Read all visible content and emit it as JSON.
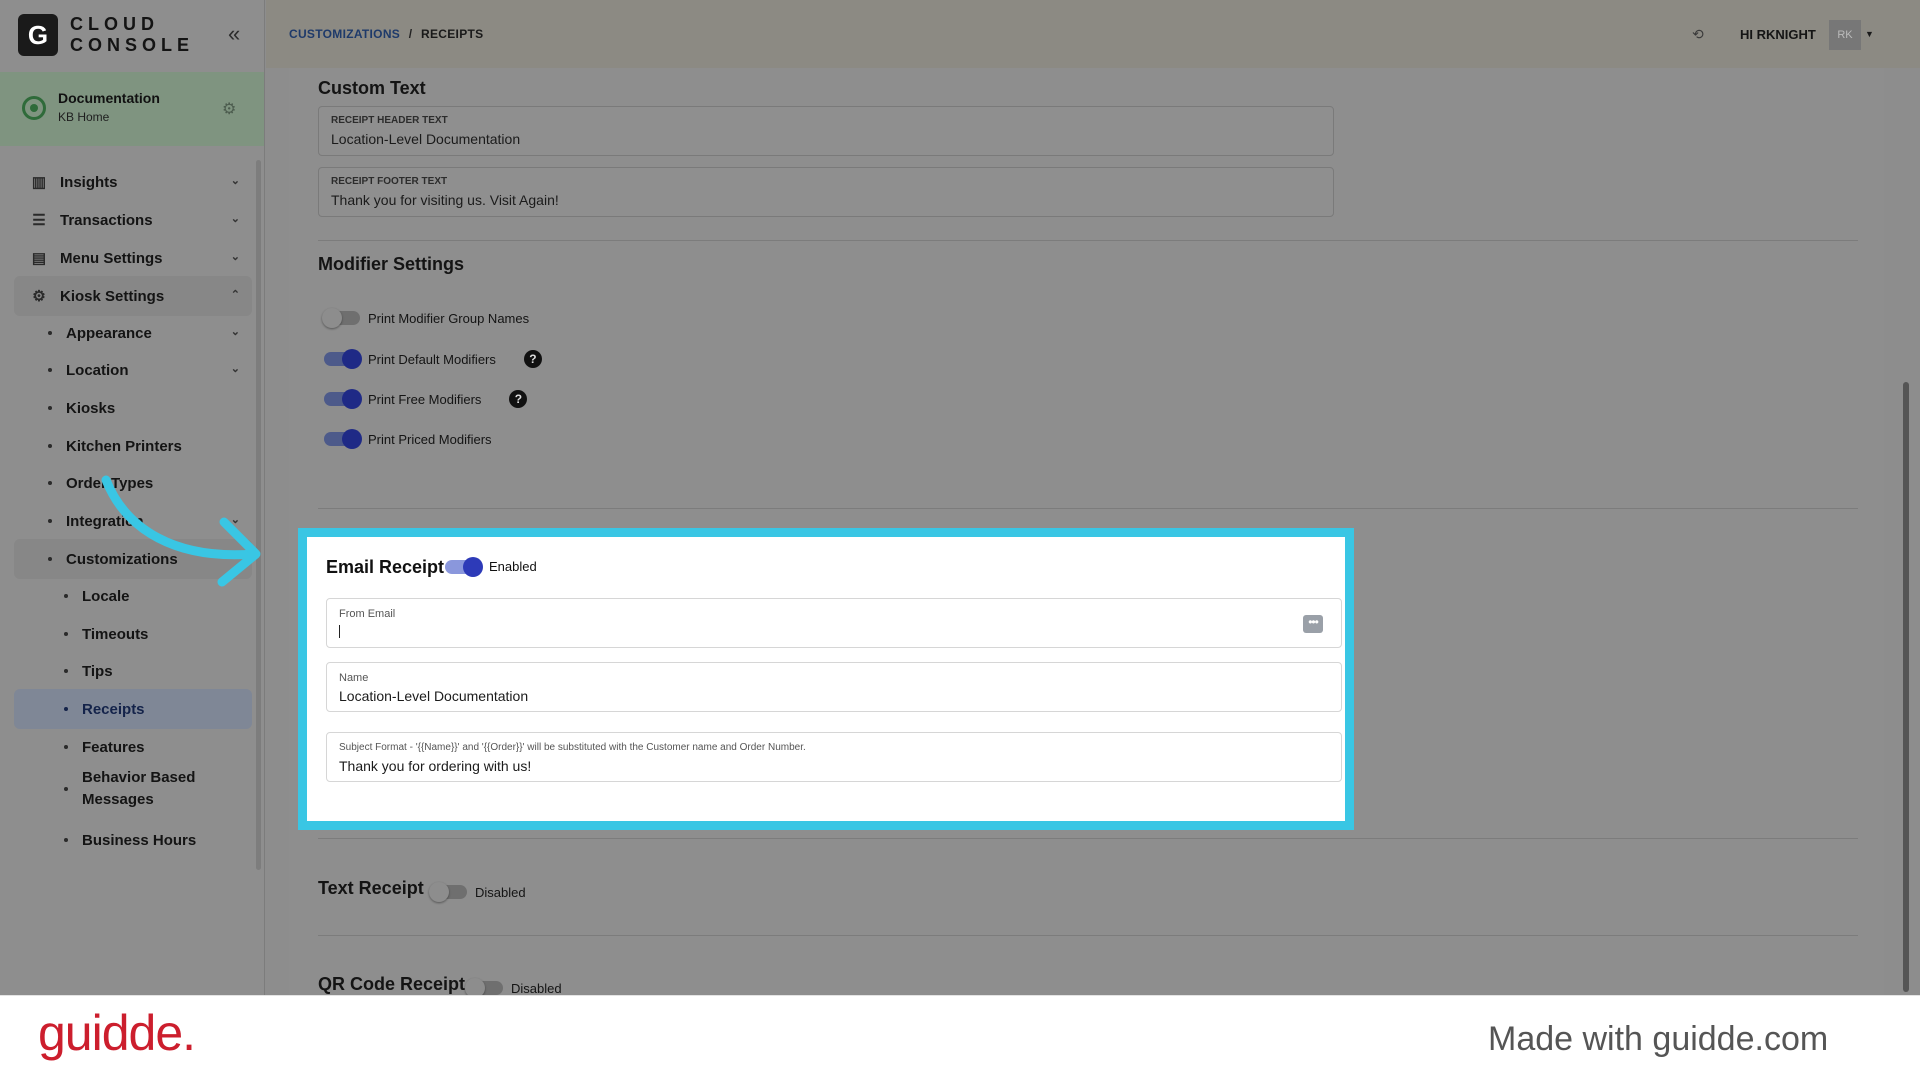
{
  "app": {
    "logo_letter": "G",
    "logo_line1": "CLOUD",
    "logo_line2": "CONSOLE"
  },
  "location": {
    "title": "Documentation",
    "subtitle": "KB Home"
  },
  "nav": {
    "insights": "Insights",
    "transactions": "Transactions",
    "menu_settings": "Menu Settings",
    "kiosk_settings": "Kiosk Settings",
    "appearance": "Appearance",
    "location": "Location",
    "kiosks": "Kiosks",
    "kitchen_printers": "Kitchen Printers",
    "order_types": "Order Types",
    "integration": "Integration",
    "customizations": "Customizations",
    "locale": "Locale",
    "timeouts": "Timeouts",
    "tips": "Tips",
    "receipts": "Receipts",
    "features": "Features",
    "behavior_line1": "Behavior Based",
    "behavior_line2": "Messages",
    "business_hours": "Business Hours"
  },
  "header": {
    "crumb_parent": "CUSTOMIZATIONS",
    "crumb_sep": "/",
    "crumb_current": "RECEIPTS",
    "greeting": "HI RKNIGHT",
    "avatar_initials": "RK"
  },
  "custom_text": {
    "title": "Custom Text",
    "header_label": "RECEIPT HEADER TEXT",
    "header_value": "Location-Level Documentation",
    "footer_label": "RECEIPT FOOTER TEXT",
    "footer_value": "Thank you for visiting us. Visit Again!"
  },
  "modifier_settings": {
    "title": "Modifier Settings",
    "items": [
      {
        "label": "Print Modifier Group Names",
        "enabled": false,
        "help": false
      },
      {
        "label": "Print Default Modifiers",
        "enabled": true,
        "help": true
      },
      {
        "label": "Print Free Modifiers",
        "enabled": true,
        "help": true
      },
      {
        "label": "Print Priced Modifiers",
        "enabled": true,
        "help": false
      }
    ],
    "help_glyph": "?"
  },
  "email_receipt": {
    "title": "Email Receipt",
    "status": "Enabled",
    "from_email_label": "From Email",
    "from_email_value": "",
    "name_label": "Name",
    "name_value": "Location-Level Documentation",
    "subject_label": "Subject Format - '{{Name}}' and '{{Order}}' will be substituted with the Customer name and Order Number.",
    "subject_value": "Thank you for ordering with us!"
  },
  "text_receipt": {
    "title": "Text Receipt",
    "status": "Disabled"
  },
  "qr_receipt": {
    "title": "QR Code Receipt",
    "status": "Disabled"
  },
  "footer": {
    "brand": "guidde.",
    "made_with": "Made with guidde.com"
  },
  "colors": {
    "highlight": "#39c6e4",
    "toggle_on": "#1f2a86",
    "brand": "#cc1e2d"
  }
}
